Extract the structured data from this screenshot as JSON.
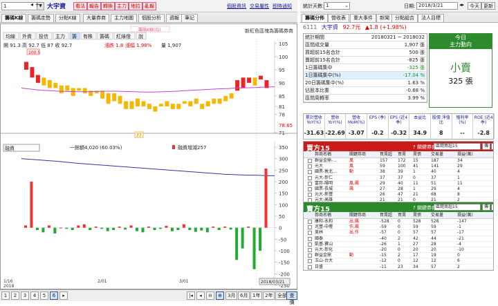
{
  "topbar": {
    "code_value": "1",
    "stock_name": "大宇資",
    "red_buttons": [
      "看法",
      "報告",
      "轉換",
      "主力",
      "地拉",
      "亂報"
    ],
    "links": [
      "個股資訊",
      "交易屬性",
      "即時通知"
    ]
  },
  "tabs": [
    "籌碼K線",
    "籌碼走勢",
    "分點K線",
    "大量券商",
    "主力地圖",
    "個股分析",
    "週報",
    "筆記"
  ],
  "ticker_text": "新紅色區塊為籌碼券商",
  "chart": {
    "toolbar": [
      "均線",
      "外資",
      "投信",
      "主力",
      "籌",
      "有株",
      "籌碼",
      "紅綠燈",
      "說"
    ],
    "floating_label": "籌碼K線(日)",
    "ohlc": "開 91.3  高 92.7  低 87  收 92.7",
    "change_text": "漲跌 1.8",
    "change_pct": "漲幅 1.98%",
    "volume_text": "量 1,907",
    "high_tag": "100.5",
    "low_tag": "77",
    "price_tag": "78.65",
    "y_ticks_top": [
      "105",
      "100",
      "95",
      "90",
      "85",
      "81",
      "78",
      "71"
    ],
    "sub_select": "融資",
    "sub_legend_1": "一餘額4,020 (60.03%)",
    "sub_legend_2": "融資增減257",
    "y_ticks_bottom": [
      "350",
      "300",
      "250",
      "200",
      "150",
      "100",
      "50",
      "0",
      "-50",
      "-100",
      "-150",
      "-200",
      "-250"
    ],
    "x_labels": [
      "1/16",
      "2018",
      "2/01",
      "3/01"
    ],
    "date_tag": "2018/03/21",
    "colors": {
      "up": "#ee2222",
      "down": "#f5b800",
      "ma": "#c43fd6",
      "sub_up": "#ee3333",
      "sub_down": "#22aa33",
      "balance": "#3333aa"
    }
  },
  "bottombar": {
    "pages": [
      "1",
      "2",
      "3",
      "4",
      "5",
      "6"
    ],
    "ranges": [
      "3月",
      "6月",
      "1年",
      "2年",
      "全部",
      "查價"
    ]
  },
  "right": {
    "count_label": "統計天數:",
    "count_value": "1",
    "date_label": "日期:",
    "date_value": "2018/3/21",
    "today_btn": "今天",
    "refresh_btn": "更新",
    "tabs": [
      "籌碼分佈",
      "營收表",
      "重大事件",
      "新聞",
      "分點組合",
      "法人目標"
    ],
    "code": "6111",
    "name": "大宇資",
    "price": "92.7元",
    "change": "▲1.8 (+1.98%)",
    "stats": [
      {
        "k": "統計期間",
        "v": "20180321 ~ 2018032"
      },
      {
        "k": "區間成交量",
        "v": "1,907 張"
      },
      {
        "k": "買超前15名合計",
        "v": "500 張"
      },
      {
        "k": "賣超前15名合計",
        "v": "-825 張"
      },
      {
        "k": "1日籌碼集中",
        "v": "-325 張"
      },
      {
        "k": "1日籌碼集中(%)",
        "v": "-17.04 %"
      },
      {
        "k": "20日籌碼集中(%)",
        "v": "1.63 %"
      },
      {
        "k": "佔股本比重",
        "v": "-0.68 %"
      },
      {
        "k": "區間周轉率",
        "v": "3.99 %"
      }
    ],
    "today_title": "今日",
    "today_sub": "主力動向",
    "today_action": "小賣",
    "today_count": "325 張",
    "metrics_headers": [
      "累計營收 YoY(%)",
      "營收 YoY(%)",
      "營收 MoM(%)",
      "EPS (季)",
      "EPS (近4季)",
      "本益比",
      "股價 淨值比",
      "殖利率 (%)",
      "ROE (近4季)"
    ],
    "metrics_values": [
      "-31.63",
      "-22.69",
      "-3.07",
      "-0.2",
      "-0.32",
      "34.9",
      "8",
      "--",
      "-2.8"
    ],
    "buy_panel": {
      "title": "買方15",
      "q": "? 關鍵券商:",
      "select": "區間買超15",
      "btn1": "傳",
      "btn2": "組",
      "headers": [
        "券商名稱",
        "關鍵券商",
        "買賣超",
        "買賣",
        "賣張",
        "交易量",
        "損益(萬)"
      ],
      "rows": [
        [
          "群益金鼎-...",
          "風",
          "157",
          "172",
          "15",
          "187",
          "34"
        ],
        [
          "元大",
          "風",
          "59",
          "100",
          "41",
          "141",
          "29"
        ],
        [
          "國票-敦北...",
          "動",
          "38",
          "39",
          "1",
          "40",
          "4"
        ],
        [
          "元大-彰仁",
          "",
          "37",
          "37",
          "0",
          "37",
          "1"
        ],
        [
          "富邦-陽明",
          "風,飆",
          "29",
          "40",
          "11",
          "51",
          "11"
        ],
        [
          "國票-長城",
          "飆",
          "27",
          "28",
          "1",
          "29",
          "4"
        ],
        [
          "元大-新豐",
          "",
          "26",
          "47",
          "21",
          "68",
          "8"
        ],
        [
          "元大-高雄",
          "",
          "21",
          "21",
          "0",
          "21",
          "2"
        ],
        [
          "日盛-鹽埕",
          "",
          "20",
          "20",
          "0",
          "20",
          "3"
        ]
      ]
    },
    "sell_panel": {
      "title": "賣方15",
      "q": "? 關鍵券商:",
      "select": "區間賣超15",
      "btn1": "傳",
      "btn2": "組",
      "headers": [
        "券商名稱",
        "關鍵券商",
        "買賣超",
        "買賣",
        "賣張",
        "交易量",
        "損益(萬)"
      ],
      "rows": [
        [
          "康和-永和",
          "出,飆",
          "-528",
          "0",
          "528",
          "528",
          "-147"
        ],
        [
          "兆豐-中壢",
          "作,飆",
          "-59",
          "0",
          "59",
          "59",
          "-1"
        ],
        [
          "美林",
          "出,作",
          "-57",
          "0",
          "57",
          "57",
          "-17"
        ],
        [
          "國泰",
          "",
          "-40",
          "2",
          "42",
          "44",
          "-21"
        ],
        [
          "凱基-寶山",
          "",
          "-26",
          "1",
          "27",
          "28",
          "-4"
        ],
        [
          "元大-彰化",
          "",
          "-20",
          "0",
          "20",
          "20",
          "-10"
        ],
        [
          "群益金鼎",
          "動",
          "-15",
          "2",
          "17",
          "19",
          "0"
        ],
        [
          "玉山-台大",
          "",
          "-12",
          "0",
          "12",
          "12",
          "6"
        ],
        [
          "日盛",
          "",
          "-11",
          "23",
          "34",
          "57",
          "2"
        ]
      ]
    }
  }
}
